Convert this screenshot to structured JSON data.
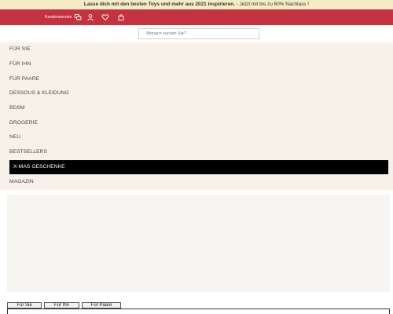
{
  "promo": {
    "headline": "Lasse dich mit den besten Toys und mehr aus 2021 inspirieren.",
    "offer": " - Jetzt mit bis zu 60% Nachlass !"
  },
  "header": {
    "service_label": "Kundenservice",
    "icons": [
      "chat-icon",
      "user-icon",
      "heart-icon",
      "bag-icon"
    ]
  },
  "search": {
    "placeholder": "Wonach suchen Sie?"
  },
  "nav": {
    "items": [
      {
        "label": "FÜR SIE"
      },
      {
        "label": "FÜR IHN"
      },
      {
        "label": "FÜR PAARE"
      },
      {
        "label": "DESSOUS & KLEIDUNG"
      },
      {
        "label": "BDSM"
      },
      {
        "label": "DROGERIE"
      },
      {
        "label": "NEU"
      },
      {
        "label": "BESTSELLERS"
      },
      {
        "label": "X-MAS GESCHENKE"
      },
      {
        "label": "MAGAZIN"
      }
    ]
  },
  "tabs": [
    {
      "label": "Für Sie"
    },
    {
      "label": "Für Ihn"
    },
    {
      "label": "Für Paare"
    }
  ],
  "colors": {
    "promo_bg": "#f5ecc6",
    "header_bg": "#c5323f",
    "nav_bg": "#f7f1ea",
    "active_bg": "#000000"
  }
}
